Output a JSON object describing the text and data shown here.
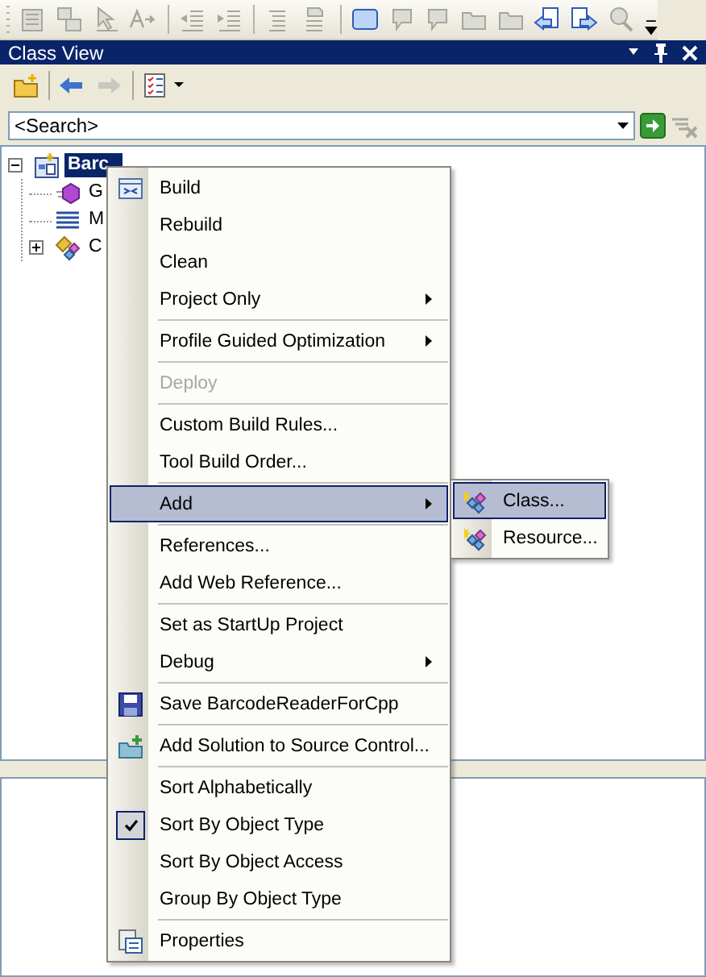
{
  "toolbar": {
    "buttons": [
      {
        "kind": "button",
        "disabled": true
      },
      {
        "kind": "button",
        "disabled": true
      },
      {
        "kind": "button",
        "disabled": true
      },
      {
        "kind": "button",
        "disabled": true
      },
      {
        "kind": "separator"
      },
      {
        "kind": "button",
        "disabled": true
      },
      {
        "kind": "button",
        "disabled": true
      },
      {
        "kind": "separator"
      },
      {
        "kind": "button",
        "disabled": true
      },
      {
        "kind": "button",
        "disabled": true
      },
      {
        "kind": "separator"
      },
      {
        "kind": "button",
        "disabled": false
      },
      {
        "kind": "button",
        "disabled": true
      },
      {
        "kind": "button",
        "disabled": true
      },
      {
        "kind": "button",
        "disabled": true
      },
      {
        "kind": "button",
        "disabled": true
      },
      {
        "kind": "button",
        "disabled": false
      },
      {
        "kind": "button",
        "disabled": false
      },
      {
        "kind": "button",
        "disabled": true
      }
    ]
  },
  "panel": {
    "title": "Class View",
    "buttons": [
      {
        "disabled": false
      },
      {
        "disabled": false
      },
      {
        "disabled": true
      },
      {
        "disabled": false
      }
    ]
  },
  "search": {
    "value": "<Search>",
    "clear_disabled": true
  },
  "tree": {
    "items": [
      {
        "label": "Barc",
        "selected": true,
        "expanded": true,
        "children": [
          {
            "label": "G",
            "selected": false
          },
          {
            "label": "M",
            "selected": false
          },
          {
            "label": "C",
            "selected": false,
            "expanded": false
          }
        ]
      }
    ]
  },
  "context_menu": {
    "items": [
      {
        "kind": "item",
        "label": "Build",
        "submenu": false,
        "disabled": false,
        "selected": false,
        "checked": false
      },
      {
        "kind": "item",
        "label": "Rebuild",
        "submenu": false,
        "disabled": false,
        "selected": false,
        "checked": false
      },
      {
        "kind": "item",
        "label": "Clean",
        "submenu": false,
        "disabled": false,
        "selected": false,
        "checked": false
      },
      {
        "kind": "item",
        "label": "Project Only",
        "submenu": true,
        "disabled": false,
        "selected": false,
        "checked": false
      },
      {
        "kind": "separator"
      },
      {
        "kind": "item",
        "label": "Profile Guided Optimization",
        "submenu": true,
        "disabled": false,
        "selected": false,
        "checked": false
      },
      {
        "kind": "separator"
      },
      {
        "kind": "item",
        "label": "Deploy",
        "submenu": false,
        "disabled": true,
        "selected": false,
        "checked": false
      },
      {
        "kind": "separator"
      },
      {
        "kind": "item",
        "label": "Custom Build Rules...",
        "submenu": false,
        "disabled": false,
        "selected": false,
        "checked": false
      },
      {
        "kind": "item",
        "label": "Tool Build Order...",
        "submenu": false,
        "disabled": false,
        "selected": false,
        "checked": false
      },
      {
        "kind": "separator"
      },
      {
        "kind": "item",
        "label": "Add",
        "submenu": true,
        "disabled": false,
        "selected": true,
        "checked": false
      },
      {
        "kind": "separator"
      },
      {
        "kind": "item",
        "label": "References...",
        "submenu": false,
        "disabled": false,
        "selected": false,
        "checked": false
      },
      {
        "kind": "item",
        "label": "Add Web Reference...",
        "submenu": false,
        "disabled": false,
        "selected": false,
        "checked": false
      },
      {
        "kind": "separator"
      },
      {
        "kind": "item",
        "label": "Set as StartUp Project",
        "submenu": false,
        "disabled": false,
        "selected": false,
        "checked": false
      },
      {
        "kind": "item",
        "label": "Debug",
        "submenu": true,
        "disabled": false,
        "selected": false,
        "checked": false
      },
      {
        "kind": "separator"
      },
      {
        "kind": "item",
        "label": "Save BarcodeReaderForCpp",
        "submenu": false,
        "disabled": false,
        "selected": false,
        "checked": false
      },
      {
        "kind": "separator"
      },
      {
        "kind": "item",
        "label": "Add Solution to Source Control...",
        "submenu": false,
        "disabled": false,
        "selected": false,
        "checked": false
      },
      {
        "kind": "separator"
      },
      {
        "kind": "item",
        "label": "Sort Alphabetically",
        "submenu": false,
        "disabled": false,
        "selected": false,
        "checked": false
      },
      {
        "kind": "item",
        "label": "Sort By Object Type",
        "submenu": false,
        "disabled": false,
        "selected": false,
        "checked": true
      },
      {
        "kind": "item",
        "label": "Sort By Object Access",
        "submenu": false,
        "disabled": false,
        "selected": false,
        "checked": false
      },
      {
        "kind": "item",
        "label": "Group By Object Type",
        "submenu": false,
        "disabled": false,
        "selected": false,
        "checked": false
      },
      {
        "kind": "separator"
      },
      {
        "kind": "item",
        "label": "Properties",
        "submenu": false,
        "disabled": false,
        "selected": false,
        "checked": false
      }
    ]
  },
  "submenu": {
    "items": [
      {
        "label": "Class...",
        "selected": true
      },
      {
        "label": "Resource...",
        "selected": false
      }
    ]
  }
}
